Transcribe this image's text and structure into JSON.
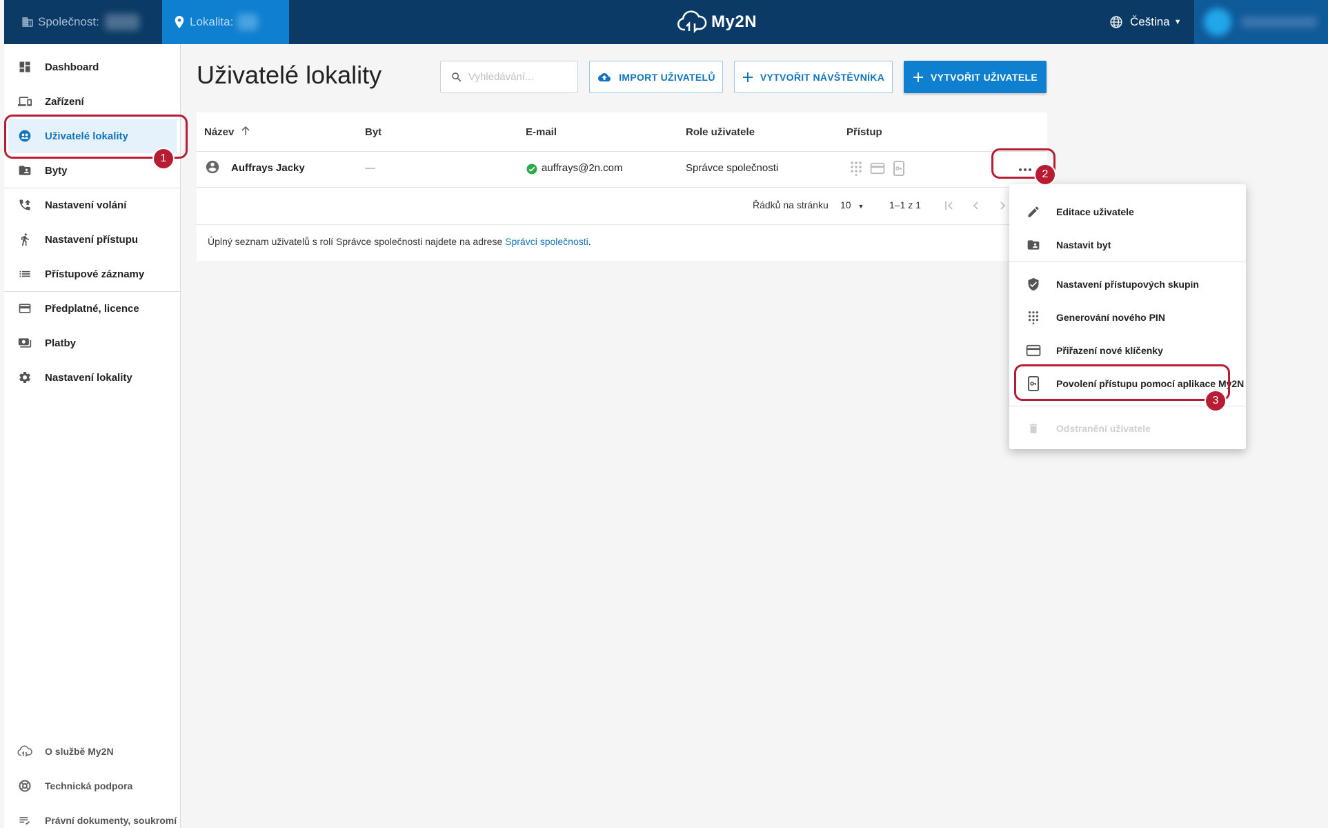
{
  "topbar": {
    "company_label": "Společnost:",
    "location_label": "Lokalita:",
    "logo_text": "My2N",
    "language": "Čeština"
  },
  "sidebar": {
    "items": [
      {
        "label": "Dashboard",
        "icon": "dashboard-icon"
      },
      {
        "label": "Zařízení",
        "icon": "device-icon"
      },
      {
        "label": "Uživatelé lokality",
        "icon": "users-icon"
      },
      {
        "label": "Byty",
        "icon": "apartment-icon"
      },
      {
        "label": "Nastavení volání",
        "icon": "call-settings-icon"
      },
      {
        "label": "Nastavení přístupu",
        "icon": "access-settings-icon"
      },
      {
        "label": "Přístupové záznamy",
        "icon": "access-log-icon"
      },
      {
        "label": "Předplatné, licence",
        "icon": "subscription-icon"
      },
      {
        "label": "Platby",
        "icon": "payments-icon"
      },
      {
        "label": "Nastavení lokality",
        "icon": "gear-icon"
      }
    ],
    "footer": [
      {
        "label": "O službě My2N",
        "icon": "cloud-icon"
      },
      {
        "label": "Technická podpora",
        "icon": "support-icon"
      },
      {
        "label": "Právní dokumenty, soukromí",
        "icon": "legal-icon"
      }
    ]
  },
  "page": {
    "title": "Uživatelé lokality",
    "search_placeholder": "Vyhledávání...",
    "import_label": "IMPORT UŽIVATELŮ",
    "visitor_label": "VYTVOŘIT NÁVŠTĚVNÍKA",
    "create_label": "VYTVOŘIT UŽIVATELE"
  },
  "table": {
    "columns": [
      "Název",
      "Byt",
      "E-mail",
      "Role uživatele",
      "Přístup"
    ],
    "rows": [
      {
        "name": "Auffrays Jacky",
        "apartment": "—",
        "email": "auffrays@2n.com",
        "role": "Správce společnosti"
      }
    ],
    "rows_per_page_label": "Řádků na stránku",
    "rows_per_page": "10",
    "range": "1–1 z 1",
    "note_text": "Úplný seznam uživatelů s rolí Správce společnosti najdete na adrese ",
    "note_link": "Správci společnosti",
    "note_end": "."
  },
  "menu": {
    "items": [
      {
        "label": "Editace uživatele",
        "icon": "pencil-icon"
      },
      {
        "label": "Nastavit byt",
        "icon": "apartment-icon"
      },
      {
        "label": "Nastavení přístupových skupin",
        "icon": "shield-icon"
      },
      {
        "label": "Generování nového PIN",
        "icon": "keypad-icon"
      },
      {
        "label": "Přiřazení nové klíčenky",
        "icon": "card-icon"
      },
      {
        "label": "Povolení přístupu pomocí aplikace My2N",
        "icon": "mobile-key-icon"
      },
      {
        "label": "Odstranění uživatele",
        "icon": "trash-icon"
      }
    ]
  },
  "badges": [
    "1",
    "2",
    "3"
  ],
  "colors": {
    "topbar": "#0b3a66",
    "accent": "#0f7fd0",
    "highlight": "#b81c33"
  }
}
